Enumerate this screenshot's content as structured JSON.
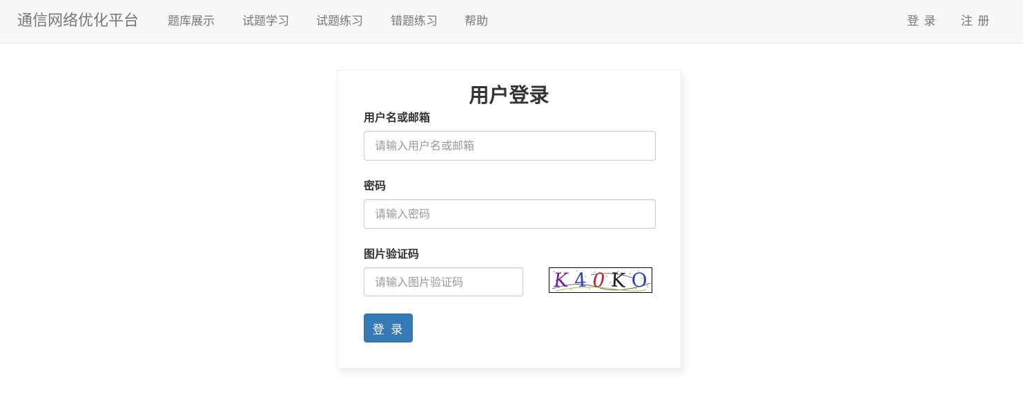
{
  "navbar": {
    "brand": "通信网络优化平台",
    "items": [
      {
        "label": "题库展示"
      },
      {
        "label": "试题学习"
      },
      {
        "label": "试题练习"
      },
      {
        "label": "错题练习"
      },
      {
        "label": "帮助"
      }
    ],
    "right": {
      "login": "登 录",
      "register": "注 册"
    }
  },
  "form": {
    "title": "用户登录",
    "username": {
      "label": "用户名或邮箱",
      "placeholder": "请输入用户名或邮箱",
      "value": ""
    },
    "password": {
      "label": "密码",
      "placeholder": "请输入密码",
      "value": ""
    },
    "captcha": {
      "label": "图片验证码",
      "placeholder": "请输入图片验证码",
      "value": "",
      "image_text": "K40KO"
    },
    "submit_label": "登 录"
  },
  "colors": {
    "navbar_bg": "#f8f8f8",
    "nav_text": "#777777",
    "primary": "#337ab7"
  }
}
